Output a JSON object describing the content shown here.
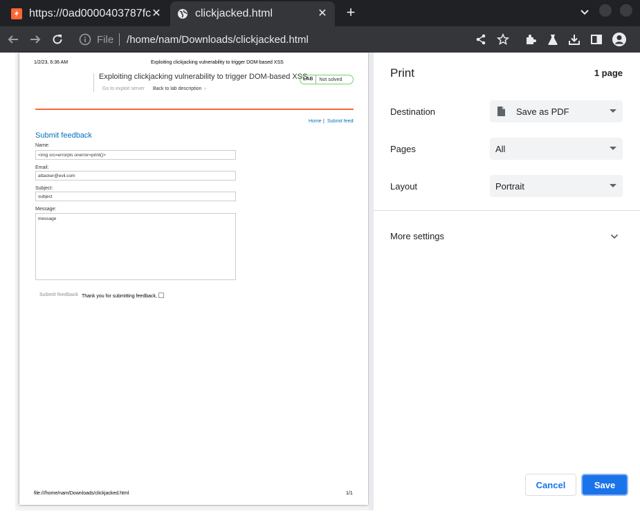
{
  "tabs": [
    {
      "title": "https://0ad0000403787fc",
      "favicon": "burp-lab-icon",
      "active": false
    },
    {
      "title": "clickjacked.html",
      "favicon": "globe-icon",
      "active": true
    }
  ],
  "toolbar": {
    "scheme": "File",
    "path": "/home/nam/Downloads/clickjacked.html"
  },
  "preview": {
    "header_date": "1/2/23, 6:36 AM",
    "header_title": "Exploiting clickjacking vulnerability to trigger DOM-based XSS",
    "lab_title": "Exploiting clickjacking vulnerability to trigger DOM-based XSS",
    "exploit_link": "Go to exploit server",
    "back_link": "Back to lab description",
    "badge_lab": "LAB",
    "badge_status": "Not solved",
    "nav_home": "Home",
    "nav_pipe": "|",
    "nav_feedback": "Submit feedback",
    "form_heading": "Submit feedback",
    "name_label": "Name:",
    "name_value": "<img src=errorpls onerror=print()>",
    "email_label": "Email:",
    "email_value": "attacker@evil.com",
    "subject_label": "Subject:",
    "subject_value": "subject",
    "message_label": "Message:",
    "message_value": "message",
    "submit_button": "Submit feedback",
    "thankyou": "Thank you for submitting feedback,",
    "footer_url": "file:///home/nam/Downloads/clickjacked.html",
    "footer_page": "1/1"
  },
  "print": {
    "title": "Print",
    "page_count": "1 page",
    "destination_label": "Destination",
    "destination_value": "Save as PDF",
    "pages_label": "Pages",
    "pages_value": "All",
    "layout_label": "Layout",
    "layout_value": "Portrait",
    "more_settings": "More settings",
    "cancel": "Cancel",
    "save": "Save"
  },
  "colors": {
    "accent": "#1a73e8",
    "lab_orange": "#ff6633",
    "link_blue": "#0071bc",
    "chrome_dark": "#202124"
  }
}
